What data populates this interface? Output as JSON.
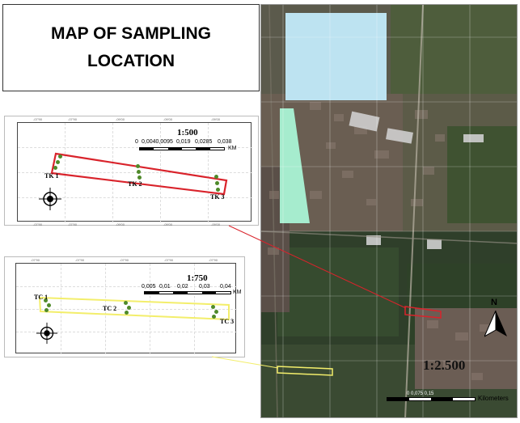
{
  "title": {
    "line1": "MAP OF SAMPLING",
    "line2": "LOCATION"
  },
  "inset_tk": {
    "scale_title": "1:500",
    "scale_ticks": [
      "0",
      "0,0040,0095",
      "0,019",
      "0,0285",
      "0,038"
    ],
    "scale_unit": "KM",
    "sites": [
      "TK 1",
      "TK 2",
      "TK 3"
    ],
    "outline_color": "#d9232b",
    "marker_color": "#4f8a2a"
  },
  "inset_tc": {
    "scale_title": "1:750",
    "scale_ticks": [
      "0,005",
      "0,01",
      "0,02",
      "0,03",
      "0,04"
    ],
    "scale_unit": "KM",
    "sites": [
      "TC 1",
      "TC 2",
      "TC 3"
    ],
    "outline_color": "#f3ee6b",
    "marker_color": "#4f8a2a"
  },
  "main_map": {
    "scale_title": "1:2.500",
    "scale_ticks": "0 0,075 0,15",
    "scale_unit": "Kilometers",
    "north_label": "N",
    "icons": [
      "north-arrow-icon",
      "compass-rose-icon"
    ]
  }
}
